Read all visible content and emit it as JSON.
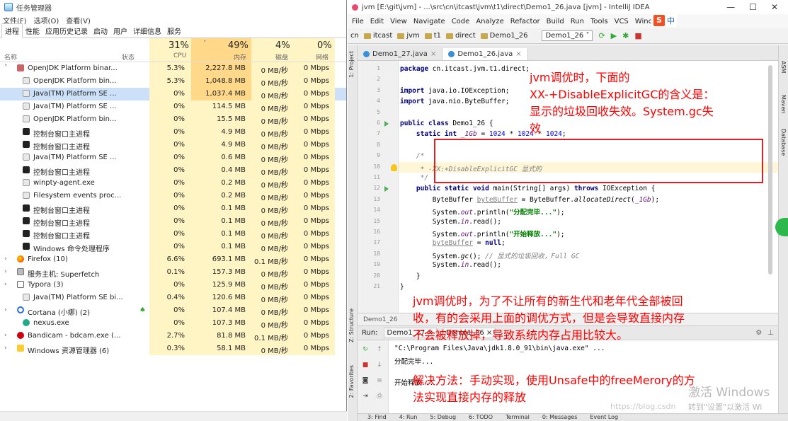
{
  "taskmgr": {
    "title": "任务管理器",
    "menu": [
      "文件(F)",
      "选项(O)",
      "查看(V)"
    ],
    "tabs": [
      "进程",
      "性能",
      "应用历史记录",
      "启动",
      "用户",
      "详细信息",
      "服务"
    ],
    "header": {
      "name": "名称",
      "status": "状态",
      "cpu_pct": "31%",
      "cpu": "CPU",
      "mem_pct": "49%",
      "mem": "内存",
      "disk_pct": "4%",
      "disk": "磁盘",
      "net_pct": "0%",
      "net": "网络"
    },
    "rows": [
      {
        "name": "OpenJDK Platform binar...",
        "cpu": "5.3%",
        "mem": "2,227.8 MB",
        "disk": "0 MB/秒",
        "net": "0 Mbps",
        "icon": "jdk-icon",
        "expand": "˅"
      },
      {
        "name": "OpenJDK Platform bin...",
        "cpu": "5.3%",
        "mem": "1,048.8 MB",
        "disk": "0 MB/秒",
        "net": "0 Mbps",
        "icon": "java-icon"
      },
      {
        "name": "Java(TM) Platform SE ...",
        "cpu": "0%",
        "mem": "1,037.4 MB",
        "disk": "0 MB/秒",
        "net": "0 Mbps",
        "icon": "java-icon"
      },
      {
        "name": "Java(TM) Platform SE ...",
        "cpu": "0%",
        "mem": "114.5 MB",
        "disk": "0 MB/秒",
        "net": "0 Mbps",
        "icon": "java-icon"
      },
      {
        "name": "OpenJDK Platform bin...",
        "cpu": "0%",
        "mem": "15.5 MB",
        "disk": "0 MB/秒",
        "net": "0 Mbps",
        "icon": "java-icon"
      },
      {
        "name": "控制台窗口主进程",
        "cpu": "0%",
        "mem": "4.9 MB",
        "disk": "0 MB/秒",
        "net": "0 Mbps",
        "icon": "console-icon"
      },
      {
        "name": "控制台窗口主进程",
        "cpu": "0%",
        "mem": "4.9 MB",
        "disk": "0 MB/秒",
        "net": "0 Mbps",
        "icon": "console-icon"
      },
      {
        "name": "Java(TM) Platform SE ...",
        "cpu": "0%",
        "mem": "0.6 MB",
        "disk": "0 MB/秒",
        "net": "0 Mbps",
        "icon": "java-icon"
      },
      {
        "name": "控制台窗口主进程",
        "cpu": "0%",
        "mem": "0.4 MB",
        "disk": "0 MB/秒",
        "net": "0 Mbps",
        "icon": "console-icon"
      },
      {
        "name": "winpty-agent.exe",
        "cpu": "0%",
        "mem": "0.2 MB",
        "disk": "0 MB/秒",
        "net": "0 Mbps",
        "icon": "java-icon"
      },
      {
        "name": "Filesystem events proc...",
        "cpu": "0%",
        "mem": "0.2 MB",
        "disk": "0 MB/秒",
        "net": "0 Mbps",
        "icon": "java-icon"
      },
      {
        "name": "控制台窗口主进程",
        "cpu": "0%",
        "mem": "0.1 MB",
        "disk": "0 MB/秒",
        "net": "0 Mbps",
        "icon": "console-icon"
      },
      {
        "name": "控制台窗口主进程",
        "cpu": "0%",
        "mem": "0.1 MB",
        "disk": "0 MB/秒",
        "net": "0 Mbps",
        "icon": "console-icon"
      },
      {
        "name": "控制台窗口主进程",
        "cpu": "0%",
        "mem": "0.1 MB",
        "disk": "0 MB/秒",
        "net": "0 Mbps",
        "icon": "console-icon"
      },
      {
        "name": "Windows 命令处理程序",
        "cpu": "0%",
        "mem": "0.1 MB",
        "disk": "0 MB/秒",
        "net": "0 Mbps",
        "icon": "console-icon"
      },
      {
        "name": "Firefox (10)",
        "cpu": "6.6%",
        "mem": "693.1 MB",
        "disk": "0.1 MB/秒",
        "net": "0 Mbps",
        "icon": "firefox-icon",
        "expand": "›"
      },
      {
        "name": "服务主机: Superfetch",
        "cpu": "0.1%",
        "mem": "157.3 MB",
        "disk": "0 MB/秒",
        "net": "0 Mbps",
        "icon": "service-icon",
        "expand": "›"
      },
      {
        "name": "Typora (3)",
        "cpu": "0%",
        "mem": "125.9 MB",
        "disk": "0 MB/秒",
        "net": "0 Mbps",
        "icon": "typora-icon",
        "expand": "›"
      },
      {
        "name": "Java(TM) Platform SE bi...",
        "cpu": "0.4%",
        "mem": "120.6 MB",
        "disk": "0 MB/秒",
        "net": "0 Mbps",
        "icon": "java-icon"
      },
      {
        "name": "Cortana (小娜) (2)",
        "cpu": "0%",
        "mem": "107.4 MB",
        "disk": "0 MB/秒",
        "net": "0 Mbps",
        "icon": "cortana-icon",
        "expand": "›"
      },
      {
        "name": "nexus.exe",
        "cpu": "0%",
        "mem": "107.3 MB",
        "disk": "0 MB/秒",
        "net": "0 Mbps",
        "icon": "nexus-icon"
      },
      {
        "name": "Bandicam - bdcam.exe (...",
        "cpu": "2.7%",
        "mem": "81.8 MB",
        "disk": "0.1 MB/秒",
        "net": "0 Mbps",
        "icon": "bandicam-icon",
        "expand": "›"
      },
      {
        "name": "Windows 资源管理器 (6)",
        "cpu": "0.3%",
        "mem": "58.1 MB",
        "disk": "0 MB/秒",
        "net": "0 Mbps",
        "icon": "explorer-icon",
        "expand": "›"
      }
    ]
  },
  "idea": {
    "title": "jvm [E:\\git\\jvm] - ...\\src\\cn\\itcast\\jvm\\t1\\direct\\Demo1_26.java [jvm] - IntelliJ IDEA",
    "window_buttons": [
      "—",
      "☐",
      "✕"
    ],
    "menu": [
      "File",
      "Edit",
      "View",
      "Navigate",
      "Code",
      "Analyze",
      "Refactor",
      "Build",
      "Run",
      "Tools",
      "VCS",
      "Window"
    ],
    "breadcrumbs": [
      "cn",
      "itcast",
      "jvm",
      "t1",
      "direct",
      "Demo1_26"
    ],
    "run_config": "Demo1_26",
    "tabs": [
      "Demo1_27.java",
      "Demo1_26.java"
    ],
    "active_tab": "Demo1_26.java",
    "side_left": [
      "1: Project",
      "Z: Structure",
      "2: Favorites"
    ],
    "side_right": [
      "ASM",
      "Maven",
      "Database"
    ],
    "code": [
      {
        "n": "1",
        "html": "<span class=\"kw\">package</span> cn.itcast.jvm.t1.direct;"
      },
      {
        "n": "2",
        "html": ""
      },
      {
        "n": "3",
        "html": "<span class=\"kw\">import</span> java.io.IOException;"
      },
      {
        "n": "4",
        "html": "<span class=\"kw\">import</span> java.nio.ByteBuffer;"
      },
      {
        "n": "5",
        "html": ""
      },
      {
        "n": "6",
        "html": "<span class=\"kw\">public class</span> Demo1_26 {"
      },
      {
        "n": "7",
        "html": "    <span class=\"kw\">static int</span> <span class=\"fld\">_1Gb</span> = <span class=\"num\">1024</span> * <span class=\"num\">1024</span> * <span class=\"num\">1024</span>;"
      },
      {
        "n": "8",
        "html": ""
      },
      {
        "n": "9",
        "html": "    <span class=\"cm\">/*</span>"
      },
      {
        "n": "10",
        "html": "     <span class=\"cm\">* -XX:+DisableExplicitGC 显式的</span>"
      },
      {
        "n": "11",
        "html": "     <span class=\"cm\">*/</span>"
      },
      {
        "n": "12",
        "html": "    <span class=\"kw\">public static void</span> main(String[] args) <span class=\"kw\">throws</span> IOException {"
      },
      {
        "n": "13",
        "html": "        ByteBuffer <span class=\"unused\">byteBuffer</span> = ByteBuffer.<i>allocateDirect</i>(<span class=\"fld\">_1Gb</span>);"
      },
      {
        "n": "14",
        "html": "        System.<span class=\"fld\">out</span>.println(<span class=\"str\">\"分配完毕...\"</span>);"
      },
      {
        "n": "15",
        "html": "        System.<span class=\"fld\">in</span>.read();"
      },
      {
        "n": "16",
        "html": "        System.<span class=\"fld\">out</span>.println(<span class=\"str\">\"开始释放...\"</span>);"
      },
      {
        "n": "17",
        "html": "        <span class=\"unused\">byteBuffer</span> = <span class=\"kw\">null</span>;"
      },
      {
        "n": "18",
        "html": "        System.<i>gc</i>(); <span class=\"cm\">// 显式的垃圾回收，Full GC</span>"
      },
      {
        "n": "19",
        "html": "        System.<span class=\"fld\">in</span>.read();"
      },
      {
        "n": "20",
        "html": "    }"
      },
      {
        "n": "21",
        "html": "}"
      }
    ],
    "structure_crumb": "Demo1_26",
    "run": {
      "label": "Run:",
      "tabs": [
        "Demo1_27",
        "Demo1_26"
      ],
      "cmd": "\"C:\\Program Files\\Java\\jdk1.8.0_91\\bin\\java.exe\" ...",
      "out1": "分配完毕...",
      "out2": "开始释放..."
    },
    "statusbar": [
      "3: Find",
      "4: Run",
      "5: Debug",
      "6: TODO",
      "Terminal",
      "0: Messages",
      "Event Log"
    ]
  },
  "overlay": {
    "note_top": "jvm调优时，下面的\nXX-+DisableExplicitGC的含义是：\n显示的垃圾回收失效。System.gc失\n效",
    "note_mid": "jvm调优时，为了不让所有的新生代和老年代全部被回\n收，有的会采用上面的调优方式，但是会导致直接内存\n不会被释放掉，导致系统内存占用比较大。",
    "note_bottom": "解决方法：手动实现，使用Unsafe中的freeMerory的方\n法实现直接内存的释放",
    "watermark_main": "激活 Windows",
    "watermark_sub": "转到\"设置\"以激活 Wi",
    "blog_wm": "https://blog.csdn",
    "sogou_label": "中",
    "sogou_icon": "S"
  },
  "colors": {
    "annotation": "#ff0000",
    "cpu_fill": "#fff4c4",
    "mem_fill": "#ffd88a",
    "selected_row": "#cce0f7"
  }
}
